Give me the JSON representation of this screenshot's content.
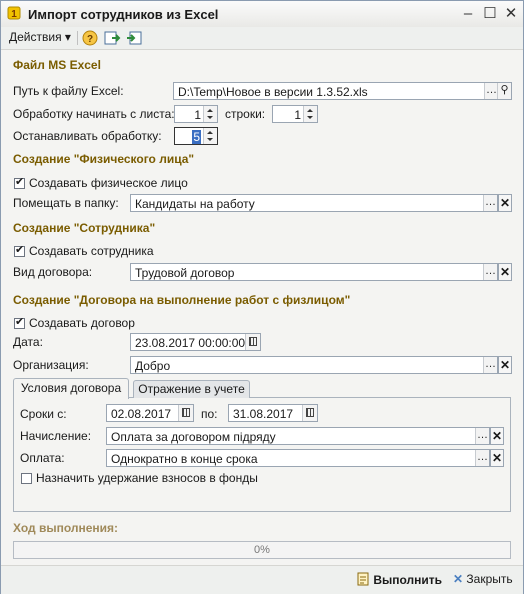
{
  "window": {
    "title": "Импорт сотрудников из Excel"
  },
  "toolbar": {
    "actions_label": "Действия",
    "actions_caret": "▾"
  },
  "excel_section": {
    "title": "Файл MS Excel",
    "path_label": "Путь к файлу Excel:",
    "path_value": "D:\\Temp\\Новое в версии 1.3.52.xls",
    "sheet_label": "Обработку начинать с листа:",
    "sheet_value": "1",
    "row_label": "строки:",
    "row_value": "1",
    "stop_label": "Останавливать обработку:",
    "stop_value": "5"
  },
  "person_section": {
    "title": "Создание \"Физического лица\"",
    "create_label": "Создавать физическое лицо",
    "create_checked": true,
    "folder_label": "Помещать в папку:",
    "folder_value": "Кандидаты на работу"
  },
  "employee_section": {
    "title": "Создание \"Сотрудника\"",
    "create_label": "Создавать сотрудника",
    "create_checked": true,
    "contract_type_label": "Вид договора:",
    "contract_type_value": "Трудовой договор"
  },
  "contract_section": {
    "title": "Создание \"Договора на выполнение работ с физлицом\"",
    "create_label": "Создавать договор",
    "create_checked": true,
    "date_label": "Дата:",
    "date_value": "23.08.2017 00:00:00",
    "org_label": "Организация:",
    "org_value": "Добро"
  },
  "tabs": [
    {
      "label": "Условия договора",
      "active": true
    },
    {
      "label": "Отражение в учете",
      "active": false
    }
  ],
  "terms": {
    "period_label": "Сроки с:",
    "from_value": "02.08.2017",
    "to_label": "по:",
    "to_value": "31.08.2017",
    "accrual_label": "Начисление:",
    "accrual_value": "Оплата за договором  підряду",
    "payment_label": "Оплата:",
    "payment_value": "Однократно в конце срока",
    "withhold_label": "Назначить удержание взносов в фонды",
    "withhold_checked": false
  },
  "progress": {
    "title": "Ход выполнения:",
    "percent": 0,
    "text": "0%"
  },
  "footer": {
    "run_label": "Выполнить",
    "close_label": "Закрыть"
  },
  "colors": {
    "section_title": "#7a5c00",
    "accent": "#6fa0d8"
  }
}
